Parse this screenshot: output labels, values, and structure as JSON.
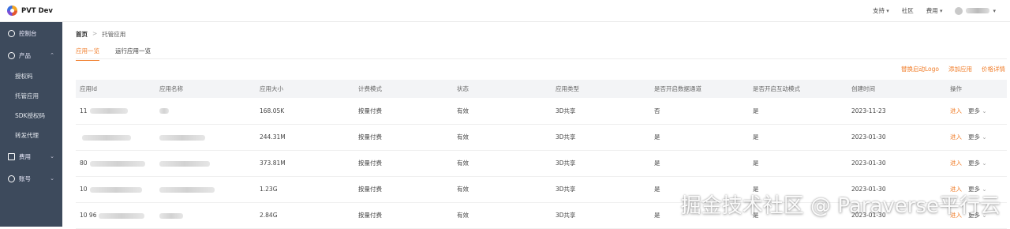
{
  "brand": {
    "name": "PVT Dev"
  },
  "topnav": {
    "support": "支持",
    "community": "社区",
    "billing": "费用"
  },
  "sidebar": {
    "console": "控制台",
    "products": "产品",
    "sub": [
      "授权码",
      "托管应用",
      "SDK授权码",
      "转发代理"
    ],
    "billing": "费用",
    "account": "账号"
  },
  "breadcrumb": {
    "home": "首页",
    "sep": ">",
    "current": "托管应用"
  },
  "tabs": [
    "应用一览",
    "运行应用一览"
  ],
  "actions": [
    "替换启动Logo",
    "添加应用",
    "价格详情"
  ],
  "table": {
    "headers": [
      "应用Id",
      "应用名称",
      "应用大小",
      "计费模式",
      "状态",
      "应用类型",
      "是否开启数据通道",
      "是否开启互动模式",
      "创建时间",
      "操作"
    ],
    "rows": [
      {
        "id": "11",
        "name": "",
        "size": "168.05K",
        "billing": "按量付费",
        "status": "有效",
        "type": "3D共享",
        "data_channel": "否",
        "interactive": "是",
        "created": "2023-11-23"
      },
      {
        "id": "",
        "name": "",
        "size": "244.31M",
        "billing": "按量付费",
        "status": "有效",
        "type": "3D共享",
        "data_channel": "是",
        "interactive": "是",
        "created": "2023-01-30"
      },
      {
        "id": "80",
        "name": "",
        "size": "373.81M",
        "billing": "按量付费",
        "status": "有效",
        "type": "3D共享",
        "data_channel": "是",
        "interactive": "是",
        "created": "2023-01-30"
      },
      {
        "id": "10",
        "name": "",
        "size": "1.23G",
        "billing": "按量付费",
        "status": "有效",
        "type": "3D共享",
        "data_channel": "是",
        "interactive": "是",
        "created": "2023-01-30"
      },
      {
        "id": "10 96",
        "name": "",
        "size": "2.84G",
        "billing": "按量付费",
        "status": "有效",
        "type": "3D共享",
        "data_channel": "是",
        "interactive": "是",
        "created": "2023-01-30"
      }
    ],
    "op_enter": "进入",
    "op_more": "更多"
  },
  "watermark": "掘金技术社区 @ Paraverse平行云"
}
